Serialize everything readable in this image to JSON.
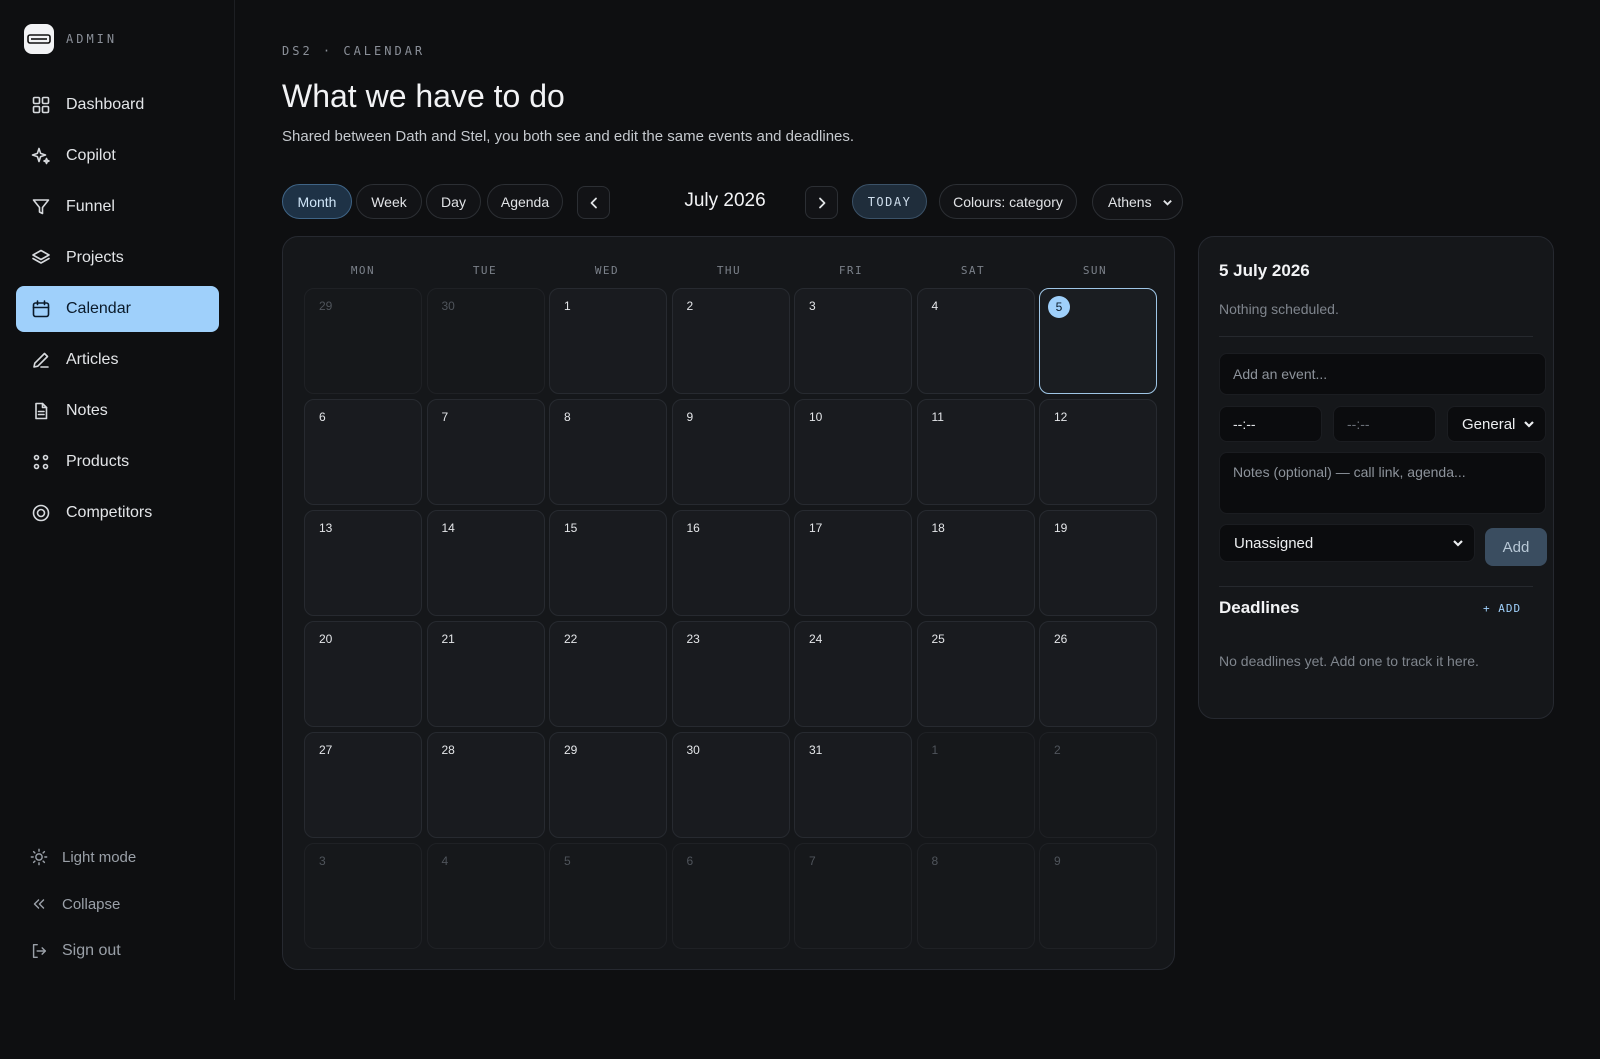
{
  "brand": {
    "logo_text": "DS2",
    "label": "ADMIN"
  },
  "nav": {
    "items": [
      {
        "label": "Dashboard",
        "icon": "grid-icon"
      },
      {
        "label": "Copilot",
        "icon": "sparkle-icon"
      },
      {
        "label": "Funnel",
        "icon": "funnel-icon"
      },
      {
        "label": "Projects",
        "icon": "layers-icon"
      },
      {
        "label": "Calendar",
        "icon": "calendar-icon",
        "active": true
      },
      {
        "label": "Articles",
        "icon": "pen-icon"
      },
      {
        "label": "Notes",
        "icon": "document-icon"
      },
      {
        "label": "Products",
        "icon": "dots-icon"
      },
      {
        "label": "Competitors",
        "icon": "target-icon"
      }
    ],
    "bottom": {
      "light_mode": "Light mode",
      "collapse": "Collapse",
      "sign_out": "Sign out"
    }
  },
  "header": {
    "eyebrow": "DS2 · CALENDAR",
    "title": "What we have to do",
    "subtitle": "Shared between Dath and Stel, you both see and edit the same events and deadlines."
  },
  "toolbar": {
    "views": [
      "Month",
      "Week",
      "Day",
      "Agenda"
    ],
    "active_view": "Month",
    "month_label": "July 2026",
    "today_label": "TODAY",
    "colours_label": "Colours: category",
    "timezone": "Athens"
  },
  "calendar": {
    "weekdays": [
      "MON",
      "TUE",
      "WED",
      "THU",
      "FRI",
      "SAT",
      "SUN"
    ],
    "selected_day": "5",
    "days": [
      {
        "n": "29",
        "muted": true
      },
      {
        "n": "30",
        "muted": true
      },
      {
        "n": "1"
      },
      {
        "n": "2"
      },
      {
        "n": "3"
      },
      {
        "n": "4"
      },
      {
        "n": "5",
        "selected": true
      },
      {
        "n": "6"
      },
      {
        "n": "7"
      },
      {
        "n": "8"
      },
      {
        "n": "9"
      },
      {
        "n": "10"
      },
      {
        "n": "11"
      },
      {
        "n": "12"
      },
      {
        "n": "13"
      },
      {
        "n": "14"
      },
      {
        "n": "15"
      },
      {
        "n": "16"
      },
      {
        "n": "17"
      },
      {
        "n": "18"
      },
      {
        "n": "19"
      },
      {
        "n": "20"
      },
      {
        "n": "21"
      },
      {
        "n": "22"
      },
      {
        "n": "23"
      },
      {
        "n": "24"
      },
      {
        "n": "25"
      },
      {
        "n": "26"
      },
      {
        "n": "27"
      },
      {
        "n": "28"
      },
      {
        "n": "29"
      },
      {
        "n": "30"
      },
      {
        "n": "31"
      },
      {
        "n": "1",
        "muted": true
      },
      {
        "n": "2",
        "muted": true
      },
      {
        "n": "3",
        "muted": true
      },
      {
        "n": "4",
        "muted": true
      },
      {
        "n": "5",
        "muted": true
      },
      {
        "n": "6",
        "muted": true
      },
      {
        "n": "7",
        "muted": true
      },
      {
        "n": "8",
        "muted": true
      },
      {
        "n": "9",
        "muted": true
      }
    ]
  },
  "day_panel": {
    "date": "5 July 2026",
    "empty_text": "Nothing scheduled.",
    "event_placeholder": "Add an event...",
    "start_time": "--:--",
    "end_time": "--:--",
    "category": "General",
    "notes_placeholder": "Notes (optional) — call link, agenda...",
    "assignee": "Unassigned",
    "add_label": "Add",
    "deadlines_title": "Deadlines",
    "deadlines_add": "+ ADD",
    "deadlines_empty": "No deadlines yet. Add one to track it here."
  },
  "colors": {
    "accent": "#9fd0fb",
    "background": "#0e0f11",
    "panel": "#15171a"
  }
}
